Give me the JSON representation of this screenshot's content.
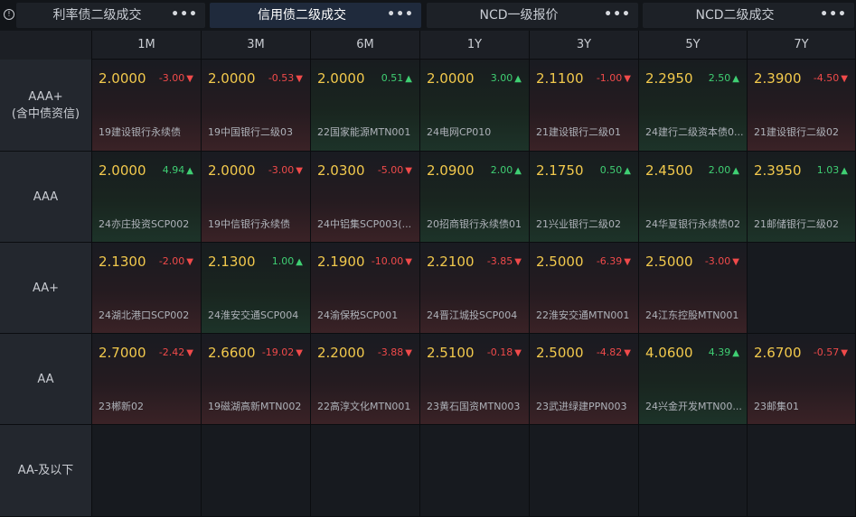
{
  "tabs": [
    {
      "label": "利率债二级成交",
      "active": false
    },
    {
      "label": "信用债二级成交",
      "active": true
    },
    {
      "label": "NCD一级报价",
      "active": false
    },
    {
      "label": "NCD二级成交",
      "active": false
    }
  ],
  "more_label": "•••",
  "info_icon": "info-icon",
  "columns": [
    "1M",
    "3M",
    "6M",
    "1Y",
    "3Y",
    "5Y",
    "7Y"
  ],
  "rows": [
    {
      "label": "AAA+",
      "sublabel": "(含中债资信)",
      "cells": [
        {
          "yield": "2.0000",
          "change": "-3.00",
          "dir": "down",
          "bond": "19建设银行永续债"
        },
        {
          "yield": "2.0000",
          "change": "-0.53",
          "dir": "down",
          "bond": "19中国银行二级03"
        },
        {
          "yield": "2.0000",
          "change": "0.51",
          "dir": "up",
          "bond": "22国家能源MTN001"
        },
        {
          "yield": "2.0000",
          "change": "3.00",
          "dir": "up",
          "bond": "24电网CP010"
        },
        {
          "yield": "2.1100",
          "change": "-1.00",
          "dir": "down",
          "bond": "21建设银行二级01"
        },
        {
          "yield": "2.2950",
          "change": "2.50",
          "dir": "up",
          "bond": "24建行二级资本债0..."
        },
        {
          "yield": "2.3900",
          "change": "-4.50",
          "dir": "down",
          "bond": "21建设银行二级02"
        }
      ]
    },
    {
      "label": "AAA",
      "sublabel": "",
      "cells": [
        {
          "yield": "2.0000",
          "change": "4.94",
          "dir": "up",
          "bond": "24亦庄投资SCP002"
        },
        {
          "yield": "2.0000",
          "change": "-3.00",
          "dir": "down",
          "bond": "19中信银行永续债"
        },
        {
          "yield": "2.0300",
          "change": "-5.00",
          "dir": "down",
          "bond": "24中铝集SCP003(..."
        },
        {
          "yield": "2.0900",
          "change": "2.00",
          "dir": "up",
          "bond": "20招商银行永续债01"
        },
        {
          "yield": "2.1750",
          "change": "0.50",
          "dir": "up",
          "bond": "21兴业银行二级02"
        },
        {
          "yield": "2.4500",
          "change": "2.00",
          "dir": "up",
          "bond": "24华夏银行永续债02"
        },
        {
          "yield": "2.3950",
          "change": "1.03",
          "dir": "up",
          "bond": "21邮储银行二级02"
        }
      ]
    },
    {
      "label": "AA+",
      "sublabel": "",
      "cells": [
        {
          "yield": "2.1300",
          "change": "-2.00",
          "dir": "down",
          "bond": "24湖北港口SCP002"
        },
        {
          "yield": "2.1300",
          "change": "1.00",
          "dir": "up",
          "bond": "24淮安交通SCP004"
        },
        {
          "yield": "2.1900",
          "change": "-10.00",
          "dir": "down",
          "bond": "24渝保税SCP001"
        },
        {
          "yield": "2.2100",
          "change": "-3.85",
          "dir": "down",
          "bond": "24晋江城投SCP004"
        },
        {
          "yield": "2.5000",
          "change": "-6.39",
          "dir": "down",
          "bond": "22淮安交通MTN001"
        },
        {
          "yield": "2.5000",
          "change": "-3.00",
          "dir": "down",
          "bond": "24江东控股MTN001"
        },
        null
      ]
    },
    {
      "label": "AA",
      "sublabel": "",
      "cells": [
        {
          "yield": "2.7000",
          "change": "-2.42",
          "dir": "down",
          "bond": "23郴新02"
        },
        {
          "yield": "2.6600",
          "change": "-19.02",
          "dir": "down",
          "bond": "19磁湖高新MTN002"
        },
        {
          "yield": "2.2000",
          "change": "-3.88",
          "dir": "down",
          "bond": "22高淳文化MTN001"
        },
        {
          "yield": "2.5100",
          "change": "-0.18",
          "dir": "down",
          "bond": "23黄石国资MTN003"
        },
        {
          "yield": "2.5000",
          "change": "-4.82",
          "dir": "down",
          "bond": "23武进绿建PPN003"
        },
        {
          "yield": "4.0600",
          "change": "4.39",
          "dir": "up",
          "bond": "24兴金开发MTN00..."
        },
        {
          "yield": "2.6700",
          "change": "-0.57",
          "dir": "down",
          "bond": "23邮集01"
        }
      ]
    },
    {
      "label": "AA-及以下",
      "sublabel": "",
      "cells": [
        null,
        null,
        null,
        null,
        null,
        null,
        null
      ]
    }
  ],
  "colors": {
    "yield": "#f2c94c",
    "down": "#f04a4a",
    "up": "#3fcf73",
    "active_tab": "#1f2a3c"
  }
}
